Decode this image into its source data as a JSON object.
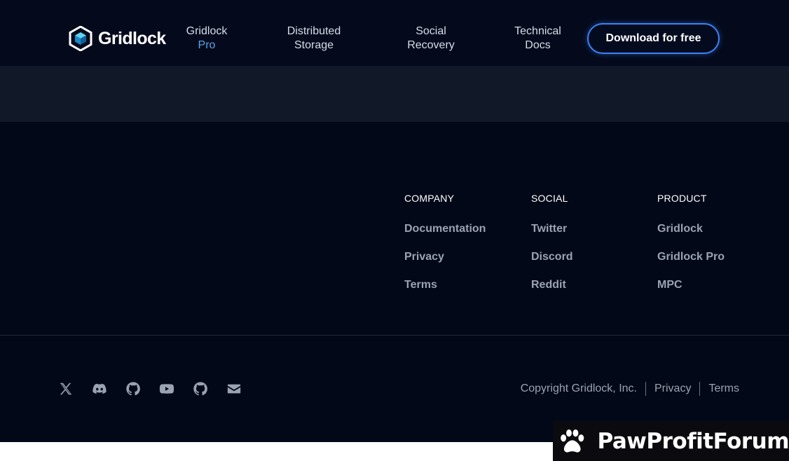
{
  "header": {
    "logo_text": "Gridlock",
    "nav": [
      {
        "line1": "Gridlock",
        "line2": "Pro"
      },
      {
        "line1": "Distributed",
        "line2": "Storage"
      },
      {
        "line1": "Social",
        "line2": "Recovery"
      },
      {
        "line1": "Technical",
        "line2": "Docs"
      }
    ],
    "cta_label": "Download for free",
    "accent_color": "#3b82f6"
  },
  "footer": {
    "columns": [
      {
        "heading": "COMPANY",
        "links": [
          "Documentation",
          "Privacy",
          "Terms"
        ]
      },
      {
        "heading": "SOCIAL",
        "links": [
          "Twitter",
          "Discord",
          "Reddit"
        ]
      },
      {
        "heading": "PRODUCT",
        "links": [
          "Gridlock",
          "Gridlock Pro",
          "MPC"
        ]
      }
    ],
    "social_icons": [
      "x-icon",
      "discord-icon",
      "github-icon",
      "youtube-icon",
      "github-icon",
      "mail-icon"
    ],
    "copyright": "Copyright Gridlock, Inc.",
    "legal_links": [
      "Privacy",
      "Terms"
    ]
  },
  "watermark": {
    "text": "PawProfitForum"
  }
}
